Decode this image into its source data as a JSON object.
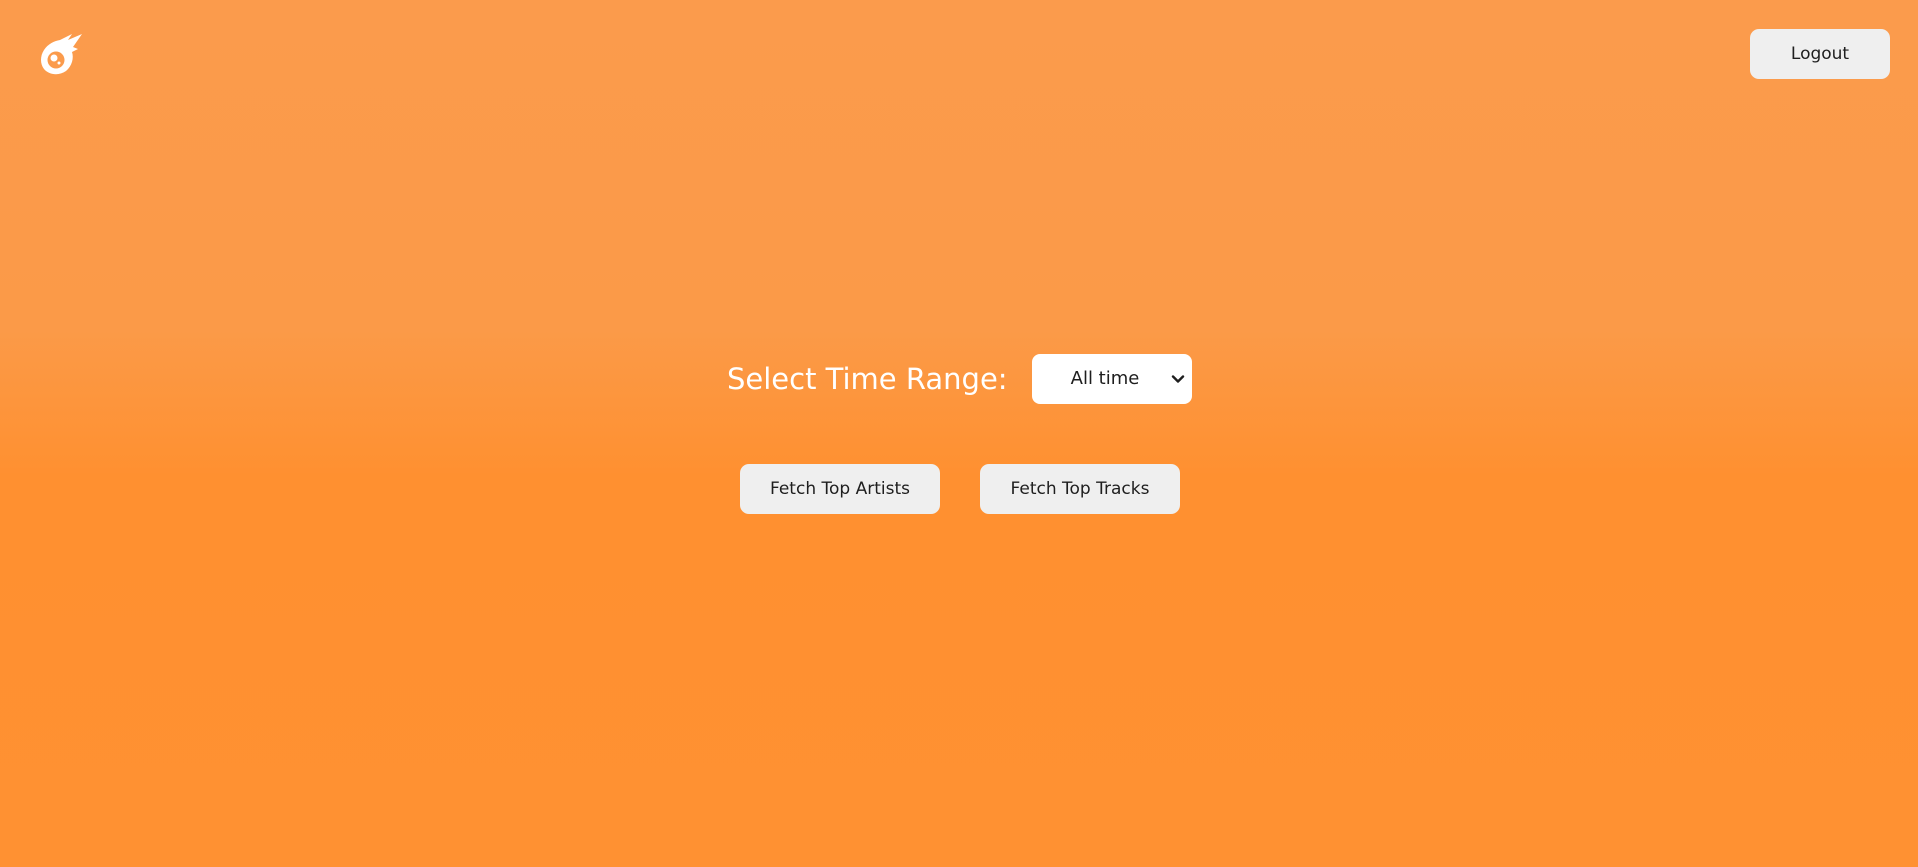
{
  "app": {
    "logo_icon": "comet-logo-icon",
    "background_top": "#fb9b4c",
    "background_bottom": "#ff9132"
  },
  "header": {
    "logout_label": "Logout"
  },
  "main": {
    "time_range_label": "Select Time Range:",
    "time_range_selected": "All time",
    "fetch_artists_label": "Fetch Top Artists",
    "fetch_tracks_label": "Fetch Top Tracks"
  }
}
